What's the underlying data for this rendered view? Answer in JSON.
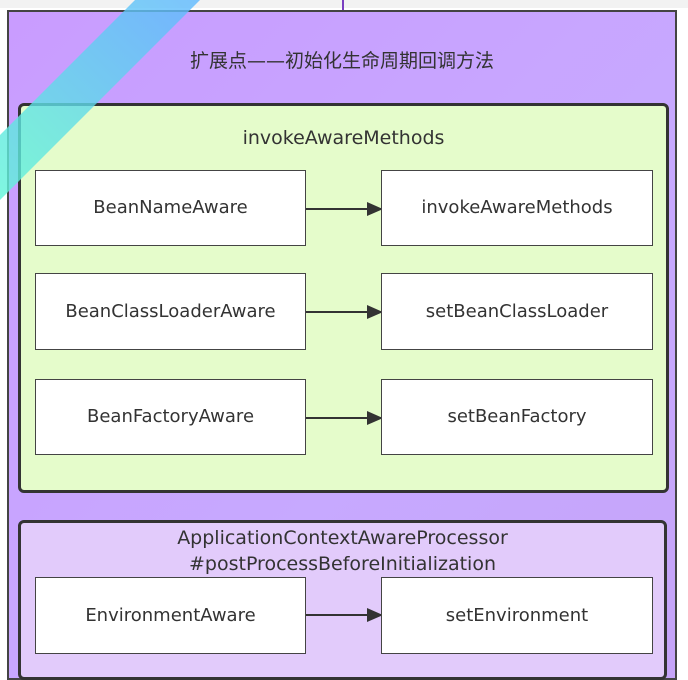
{
  "title": "扩展点——初始化生命周期回调方法",
  "groups": [
    {
      "title": "invokeAwareMethods",
      "rows": [
        {
          "from": "BeanNameAware",
          "to": "invokeAwareMethods"
        },
        {
          "from": "BeanClassLoaderAware",
          "to": "setBeanClassLoader"
        },
        {
          "from": "BeanFactoryAware",
          "to": "setBeanFactory"
        }
      ]
    },
    {
      "title_line1": "ApplicationContextAwareProcessor",
      "title_line2": "#postProcessBeforeInitialization",
      "rows": [
        {
          "from": "EnvironmentAware",
          "to": "setEnvironment"
        }
      ]
    }
  ]
}
